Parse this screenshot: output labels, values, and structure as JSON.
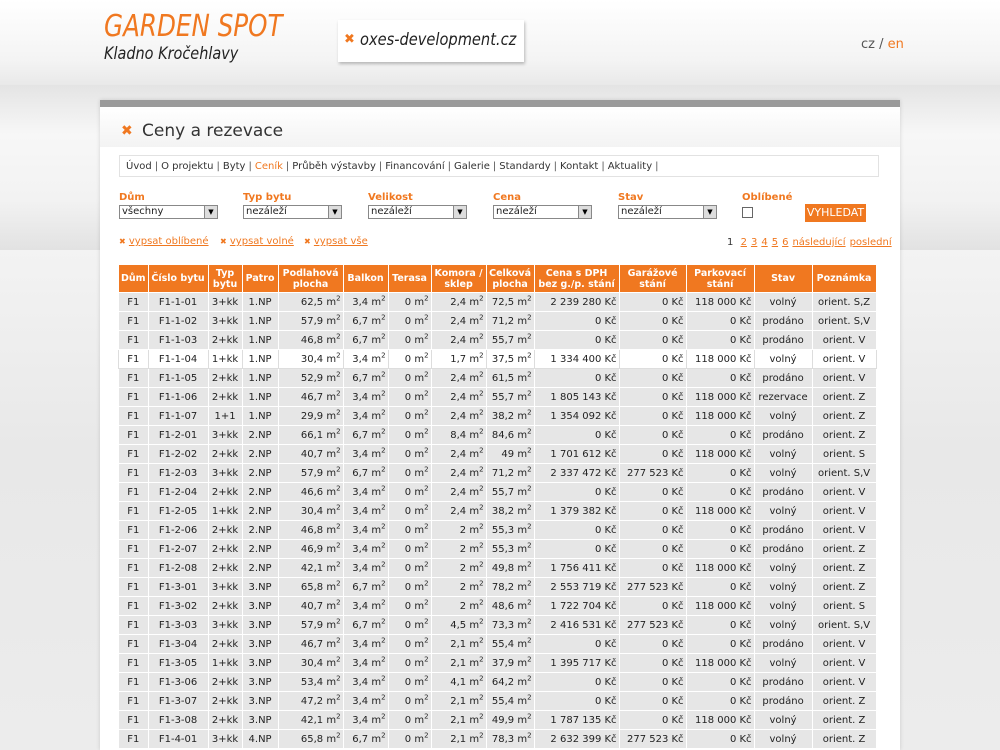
{
  "header": {
    "title": "GARDEN SPOT",
    "subtitle": "Kladno Kročehlavy",
    "developer_link": "oxes-development.cz",
    "lang_cz": "cz",
    "lang_sep": "/",
    "lang_en": "en"
  },
  "page": {
    "title": "Ceny a rezevace"
  },
  "nav": [
    "Úvod",
    "O projektu",
    "Byty",
    "Ceník",
    "Průběh výstavby",
    "Financování",
    "Galerie",
    "Standardy",
    "Kontakt",
    "Aktuality"
  ],
  "nav_active": "Ceník",
  "filters": {
    "dum": {
      "label": "Dům",
      "value": "všechny"
    },
    "typ": {
      "label": "Typ bytu",
      "value": "nezáleží"
    },
    "velikost": {
      "label": "Velikost",
      "value": "nezáleží"
    },
    "cena": {
      "label": "Cena",
      "value": "nezáleží"
    },
    "stav": {
      "label": "Stav",
      "value": "nezáleží"
    },
    "oblibene": {
      "label": "Oblíbené",
      "checked": false
    },
    "search_button": "VYHLEDAT"
  },
  "links": {
    "favorites": "vypsat oblíbené",
    "free": "vypsat volné",
    "all": "vypsat vše"
  },
  "pager": {
    "current": "1",
    "pages": [
      "2",
      "3",
      "4",
      "5",
      "6"
    ],
    "next": "následující",
    "last": "poslední"
  },
  "table": {
    "headers": [
      "Dům",
      "Číslo bytu",
      "Typ bytu",
      "Patro",
      "Podlahová plocha",
      "Balkon",
      "Terasa",
      "Komora / sklep",
      "Celková plocha",
      "Cena s DPH bez g./p. stání",
      "Garážové stání",
      "Parkovací stání",
      "Stav",
      "Poznámka"
    ],
    "unit_area": "m",
    "rows": [
      [
        "F1",
        "F1-1-01",
        "3+kk",
        "1.NP",
        "62,5",
        "3,4",
        "0",
        "2,4",
        "72,5",
        "2 239 280 Kč",
        "0 Kč",
        "118 000 Kč",
        "volný",
        "orient. S,Z"
      ],
      [
        "F1",
        "F1-1-02",
        "3+kk",
        "1.NP",
        "57,9",
        "6,7",
        "0",
        "2,4",
        "71,2",
        "0 Kč",
        "0 Kč",
        "0 Kč",
        "prodáno",
        "orient. S,V"
      ],
      [
        "F1",
        "F1-1-03",
        "2+kk",
        "1.NP",
        "46,8",
        "6,7",
        "0",
        "2,4",
        "55,7",
        "0 Kč",
        "0 Kč",
        "0 Kč",
        "prodáno",
        "orient. V"
      ],
      [
        "F1",
        "F1-1-04",
        "1+kk",
        "1.NP",
        "30,4",
        "3,4",
        "0",
        "1,7",
        "37,5",
        "1 334 400 Kč",
        "0 Kč",
        "118 000 Kč",
        "volný",
        "orient. V"
      ],
      [
        "F1",
        "F1-1-05",
        "2+kk",
        "1.NP",
        "52,9",
        "6,7",
        "0",
        "2,4",
        "61,5",
        "0 Kč",
        "0 Kč",
        "0 Kč",
        "prodáno",
        "orient. V"
      ],
      [
        "F1",
        "F1-1-06",
        "2+kk",
        "1.NP",
        "46,7",
        "3,4",
        "0",
        "2,4",
        "55,7",
        "1 805 143 Kč",
        "0 Kč",
        "118 000 Kč",
        "rezervace",
        "orient. Z"
      ],
      [
        "F1",
        "F1-1-07",
        "1+1",
        "1.NP",
        "29,9",
        "3,4",
        "0",
        "2,4",
        "38,2",
        "1 354 092 Kč",
        "0 Kč",
        "118 000 Kč",
        "volný",
        "orient. Z"
      ],
      [
        "F1",
        "F1-2-01",
        "3+kk",
        "2.NP",
        "66,1",
        "6,7",
        "0",
        "8,4",
        "84,6",
        "0 Kč",
        "0 Kč",
        "0 Kč",
        "prodáno",
        "orient. Z"
      ],
      [
        "F1",
        "F1-2-02",
        "2+kk",
        "2.NP",
        "40,7",
        "3,4",
        "0",
        "2,4",
        "49",
        "1 701 612 Kč",
        "0 Kč",
        "118 000 Kč",
        "volný",
        "orient. S"
      ],
      [
        "F1",
        "F1-2-03",
        "3+kk",
        "2.NP",
        "57,9",
        "6,7",
        "0",
        "2,4",
        "71,2",
        "2 337 472 Kč",
        "277 523 Kč",
        "0 Kč",
        "volný",
        "orient. S,V"
      ],
      [
        "F1",
        "F1-2-04",
        "2+kk",
        "2.NP",
        "46,6",
        "3,4",
        "0",
        "2,4",
        "55,7",
        "0 Kč",
        "0 Kč",
        "0 Kč",
        "prodáno",
        "orient. V"
      ],
      [
        "F1",
        "F1-2-05",
        "1+kk",
        "2.NP",
        "30,4",
        "3,4",
        "0",
        "2,4",
        "38,2",
        "1 379 382 Kč",
        "0 Kč",
        "118 000 Kč",
        "volný",
        "orient. V"
      ],
      [
        "F1",
        "F1-2-06",
        "2+kk",
        "2.NP",
        "46,8",
        "3,4",
        "0",
        "2",
        "55,3",
        "0 Kč",
        "0 Kč",
        "0 Kč",
        "prodáno",
        "orient. V"
      ],
      [
        "F1",
        "F1-2-07",
        "2+kk",
        "2.NP",
        "46,9",
        "3,4",
        "0",
        "2",
        "55,3",
        "0 Kč",
        "0 Kč",
        "0 Kč",
        "prodáno",
        "orient. Z"
      ],
      [
        "F1",
        "F1-2-08",
        "2+kk",
        "2.NP",
        "42,1",
        "3,4",
        "0",
        "2",
        "49,8",
        "1 756 411 Kč",
        "0 Kč",
        "118 000 Kč",
        "volný",
        "orient. Z"
      ],
      [
        "F1",
        "F1-3-01",
        "3+kk",
        "3.NP",
        "65,8",
        "6,7",
        "0",
        "2",
        "78,2",
        "2 553 719 Kč",
        "277 523 Kč",
        "0 Kč",
        "volný",
        "orient. Z"
      ],
      [
        "F1",
        "F1-3-02",
        "2+kk",
        "3.NP",
        "40,7",
        "3,4",
        "0",
        "2",
        "48,6",
        "1 722 704 Kč",
        "0 Kč",
        "118 000 Kč",
        "volný",
        "orient. S"
      ],
      [
        "F1",
        "F1-3-03",
        "3+kk",
        "3.NP",
        "57,9",
        "6,7",
        "0",
        "4,5",
        "73,3",
        "2 416 531 Kč",
        "277 523 Kč",
        "0 Kč",
        "volný",
        "orient. S,V"
      ],
      [
        "F1",
        "F1-3-04",
        "2+kk",
        "3.NP",
        "46,7",
        "3,4",
        "0",
        "2,1",
        "55,4",
        "0 Kč",
        "0 Kč",
        "0 Kč",
        "prodáno",
        "orient. V"
      ],
      [
        "F1",
        "F1-3-05",
        "1+kk",
        "3.NP",
        "30,4",
        "3,4",
        "0",
        "2,1",
        "37,9",
        "1 395 717 Kč",
        "0 Kč",
        "118 000 Kč",
        "volný",
        "orient. V"
      ],
      [
        "F1",
        "F1-3-06",
        "2+kk",
        "3.NP",
        "53,4",
        "3,4",
        "0",
        "4,1",
        "64,2",
        "0 Kč",
        "0 Kč",
        "0 Kč",
        "prodáno",
        "orient. V"
      ],
      [
        "F1",
        "F1-3-07",
        "2+kk",
        "3.NP",
        "47,2",
        "3,4",
        "0",
        "2,1",
        "55,4",
        "0 Kč",
        "0 Kč",
        "0 Kč",
        "prodáno",
        "orient. Z"
      ],
      [
        "F1",
        "F1-3-08",
        "2+kk",
        "3.NP",
        "42,1",
        "3,4",
        "0",
        "2,1",
        "49,9",
        "1 787 135 Kč",
        "0 Kč",
        "118 000 Kč",
        "volný",
        "orient. Z"
      ],
      [
        "F1",
        "F1-4-01",
        "3+kk",
        "4.NP",
        "65,8",
        "6,7",
        "0",
        "2,1",
        "78,3",
        "2 632 399 Kč",
        "277 523 Kč",
        "0 Kč",
        "volný",
        "orient. Z"
      ]
    ],
    "highlight_row": 3
  }
}
